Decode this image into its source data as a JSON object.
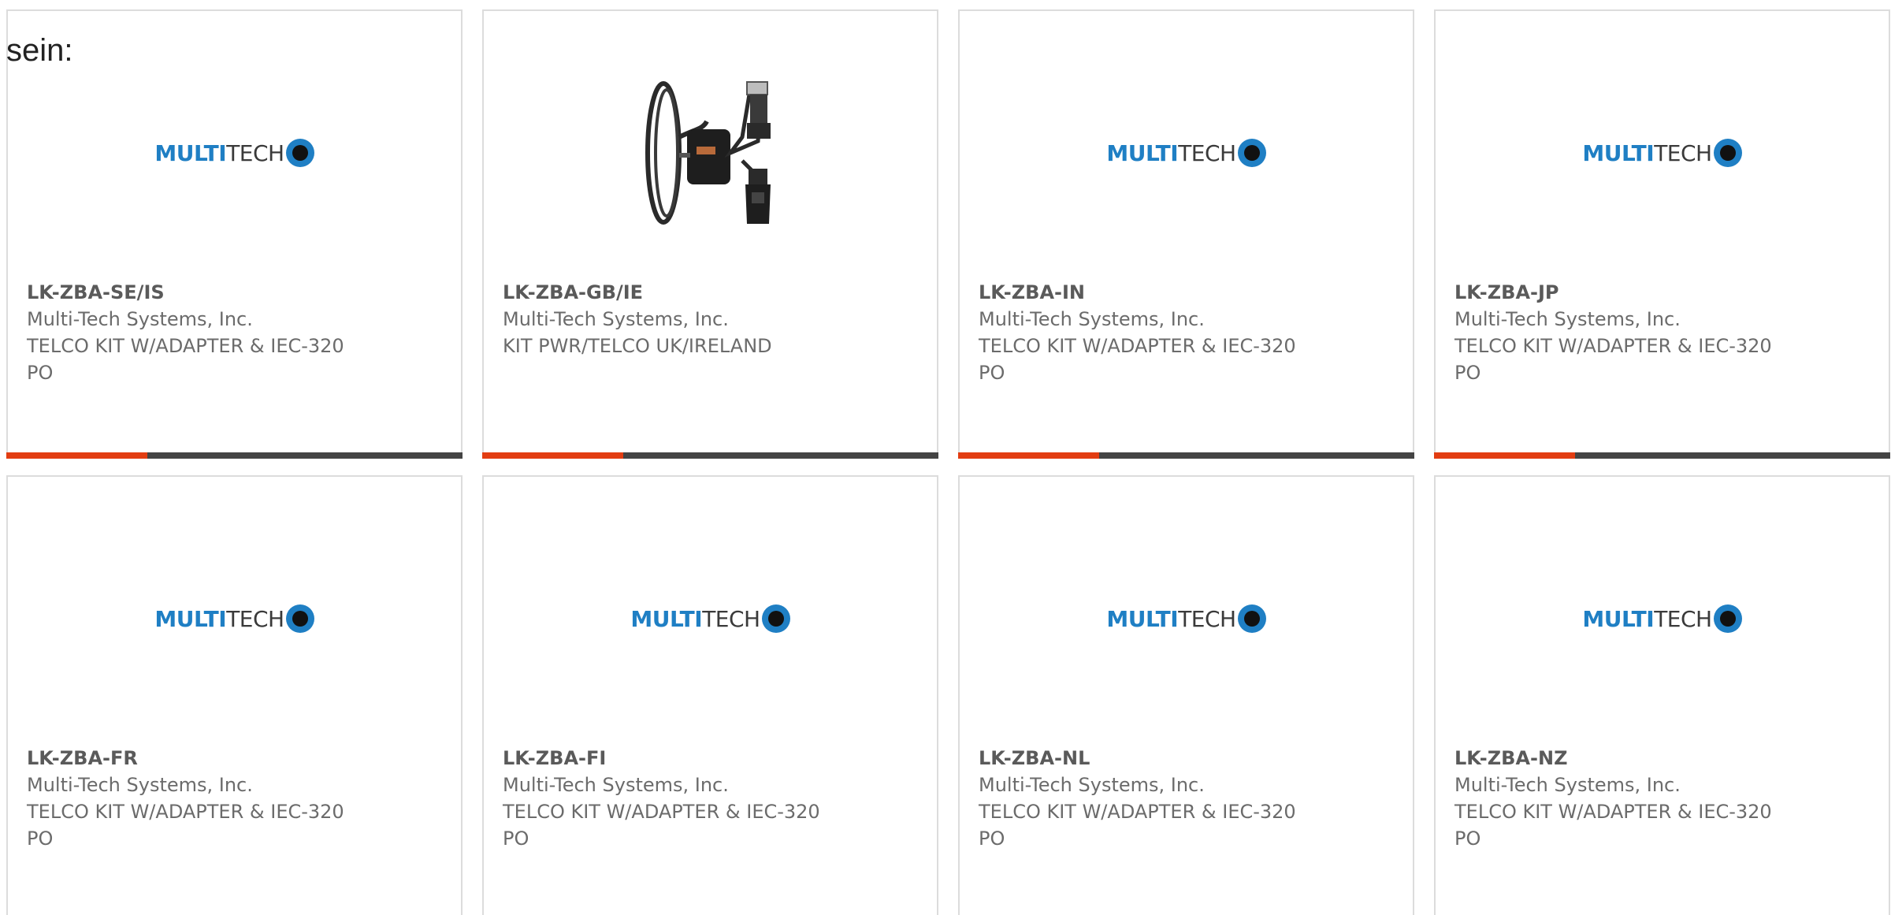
{
  "intro_text": "sein:",
  "brand": {
    "logo_multi": "MULTI",
    "logo_tech": "TECH",
    "colors": {
      "logo_blue": "#1f7fc4",
      "accent_orange": "#e23d12",
      "bar_dark": "#444444"
    }
  },
  "products": [
    {
      "part_number": "LK-ZBA-SE/IS",
      "manufacturer": "Multi-Tech Systems, Inc.",
      "description": "TELCO KIT W/ADAPTER & IEC-320 PO",
      "image": "multitech-logo",
      "progress": 0.31
    },
    {
      "part_number": "LK-ZBA-GB/IE",
      "manufacturer": "Multi-Tech Systems, Inc.",
      "description": "KIT PWR/TELCO UK/IRELAND",
      "image": "power-cable-photo",
      "progress": 0.31
    },
    {
      "part_number": "LK-ZBA-IN",
      "manufacturer": "Multi-Tech Systems, Inc.",
      "description": "TELCO KIT W/ADAPTER & IEC-320 PO",
      "image": "multitech-logo",
      "progress": 0.31
    },
    {
      "part_number": "LK-ZBA-JP",
      "manufacturer": "Multi-Tech Systems, Inc.",
      "description": "TELCO KIT W/ADAPTER & IEC-320 PO",
      "image": "multitech-logo",
      "progress": 0.31
    },
    {
      "part_number": "LK-ZBA-FR",
      "manufacturer": "Multi-Tech Systems, Inc.",
      "description": "TELCO KIT W/ADAPTER & IEC-320 PO",
      "image": "multitech-logo"
    },
    {
      "part_number": "LK-ZBA-FI",
      "manufacturer": "Multi-Tech Systems, Inc.",
      "description": "TELCO KIT W/ADAPTER & IEC-320 PO",
      "image": "multitech-logo"
    },
    {
      "part_number": "LK-ZBA-NL",
      "manufacturer": "Multi-Tech Systems, Inc.",
      "description": "TELCO KIT W/ADAPTER & IEC-320 PO",
      "image": "multitech-logo"
    },
    {
      "part_number": "LK-ZBA-NZ",
      "manufacturer": "Multi-Tech Systems, Inc.",
      "description": "TELCO KIT W/ADAPTER & IEC-320 PO",
      "image": "multitech-logo"
    }
  ]
}
